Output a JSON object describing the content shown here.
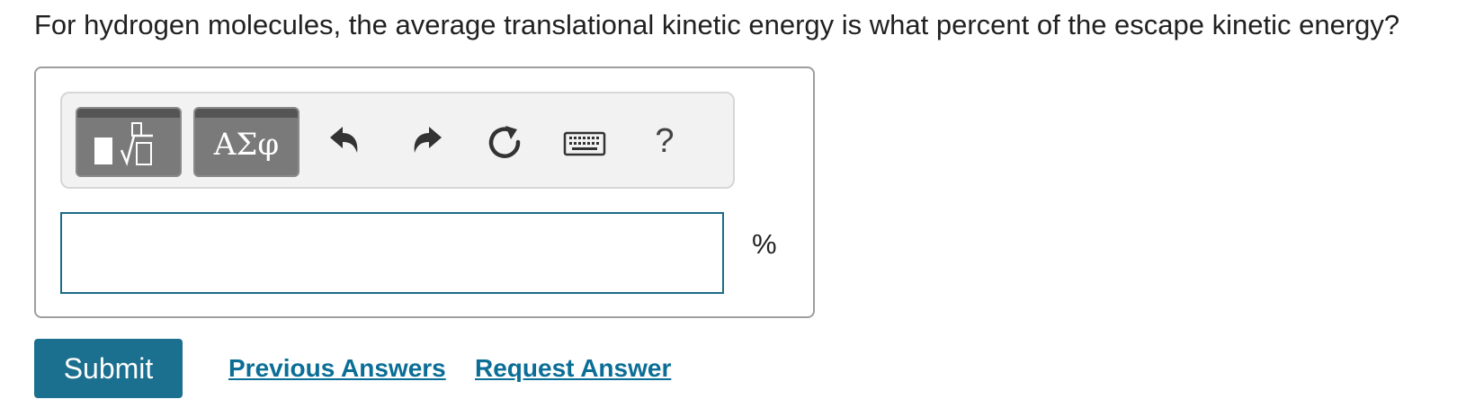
{
  "question": {
    "text": "For hydrogen molecules, the average translational kinetic energy is what percent of the escape kinetic energy?"
  },
  "toolbar": {
    "templates_icon": "templates-root-icon",
    "symbols_label": "ΑΣφ",
    "undo_icon": "undo-icon",
    "redo_icon": "redo-icon",
    "reset_icon": "reset-icon",
    "keyboard_icon": "keyboard-icon",
    "help_label": "?"
  },
  "answer": {
    "value": "",
    "unit": "%"
  },
  "actions": {
    "submit_label": "Submit",
    "previous_answers_label": "Previous Answers",
    "request_answer_label": "Request Answer"
  },
  "colors": {
    "accent": "#1b6f8f",
    "link": "#0b6e96",
    "input_border": "#1b6c87",
    "toolbar_bg": "#f2f2f2",
    "tool_button": "#7a7a7a"
  }
}
